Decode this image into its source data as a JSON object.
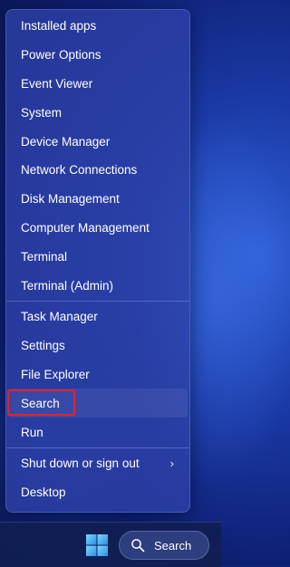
{
  "menu": {
    "group1": [
      {
        "label": "Installed apps"
      },
      {
        "label": "Power Options"
      },
      {
        "label": "Event Viewer"
      },
      {
        "label": "System"
      },
      {
        "label": "Device Manager"
      },
      {
        "label": "Network Connections"
      },
      {
        "label": "Disk Management"
      },
      {
        "label": "Computer Management"
      },
      {
        "label": "Terminal"
      },
      {
        "label": "Terminal (Admin)"
      }
    ],
    "group2": [
      {
        "label": "Task Manager"
      },
      {
        "label": "Settings"
      },
      {
        "label": "File Explorer"
      },
      {
        "label": "Search"
      },
      {
        "label": "Run"
      }
    ],
    "group3": [
      {
        "label": "Shut down or sign out",
        "chevron": "›"
      },
      {
        "label": "Desktop"
      }
    ]
  },
  "taskbar": {
    "search_label": "Search"
  },
  "colors": {
    "highlight_border": "#e8202a",
    "start_logo": "#5fc4f5"
  }
}
